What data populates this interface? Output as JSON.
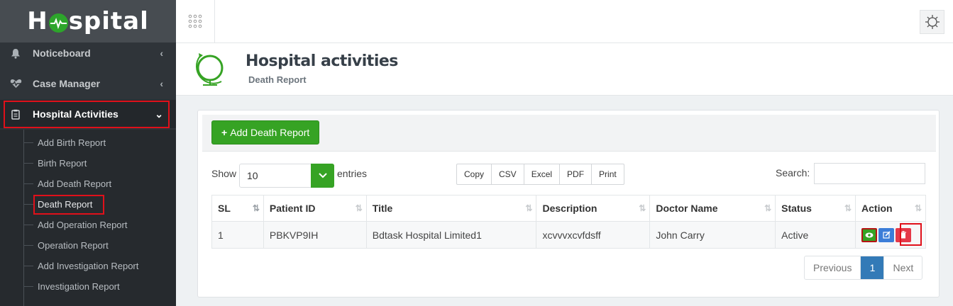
{
  "app": {
    "logo": "Hospital"
  },
  "sidebar": {
    "items": [
      {
        "label": "Noticeboard",
        "icon": "bell-icon"
      },
      {
        "label": "Case Manager",
        "icon": "heartbeat-icon"
      },
      {
        "label": "Hospital Activities",
        "icon": "clipboard-icon"
      }
    ],
    "submenu": [
      "Add Birth Report",
      "Birth Report",
      "Add Death Report",
      "Death Report",
      "Add Operation Report",
      "Operation Report",
      "Add Investigation Report",
      "Investigation Report"
    ]
  },
  "header": {
    "title": "Hospital activities",
    "subtitle": "Death Report"
  },
  "panel": {
    "add_button": "Add Death Report",
    "show_label": "Show",
    "show_value": "10",
    "entries_label": "entries",
    "export_buttons": [
      "Copy",
      "CSV",
      "Excel",
      "PDF",
      "Print"
    ],
    "search_label": "Search:",
    "search_value": ""
  },
  "table": {
    "columns": [
      "SL",
      "Patient ID",
      "Title",
      "Description",
      "Doctor Name",
      "Status",
      "Action"
    ],
    "rows": [
      [
        "1",
        "PBKVP9IH",
        "Bdtask Hospital Limited1",
        "xcvvvxcvfdsff",
        "John Carry",
        "Active"
      ]
    ]
  },
  "pagination": {
    "previous": "Previous",
    "current": "1",
    "next": "Next"
  },
  "colors": {
    "sidebar_bg": "#2f3439",
    "accent_green": "#36a324",
    "highlight_red": "#e0101a",
    "page_blue": "#337ab7"
  }
}
